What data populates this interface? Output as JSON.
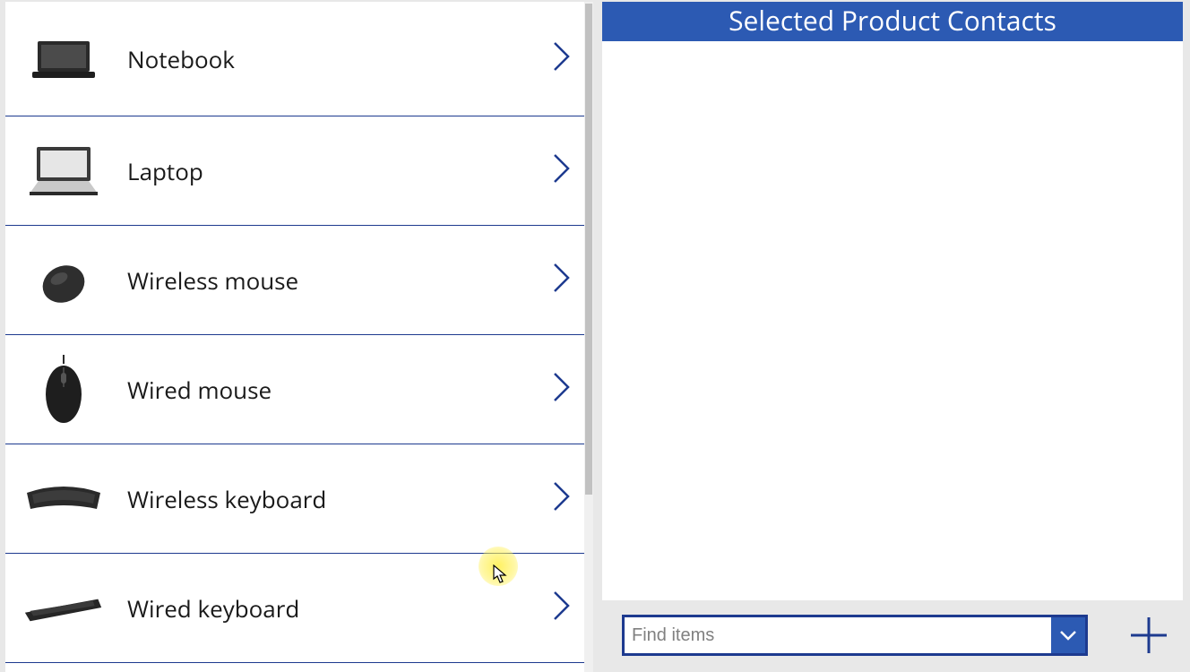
{
  "products": [
    {
      "label": "Notebook",
      "thumb": "laptop-closed"
    },
    {
      "label": "Laptop",
      "thumb": "laptop-open"
    },
    {
      "label": "Wireless mouse",
      "thumb": "mouse-diag"
    },
    {
      "label": "Wired mouse",
      "thumb": "mouse-top"
    },
    {
      "label": "Wireless keyboard",
      "thumb": "keyboard-curve"
    },
    {
      "label": "Wired keyboard",
      "thumb": "keyboard-flat"
    }
  ],
  "right_header": "Selected Product Contacts",
  "find_placeholder": "Find items"
}
